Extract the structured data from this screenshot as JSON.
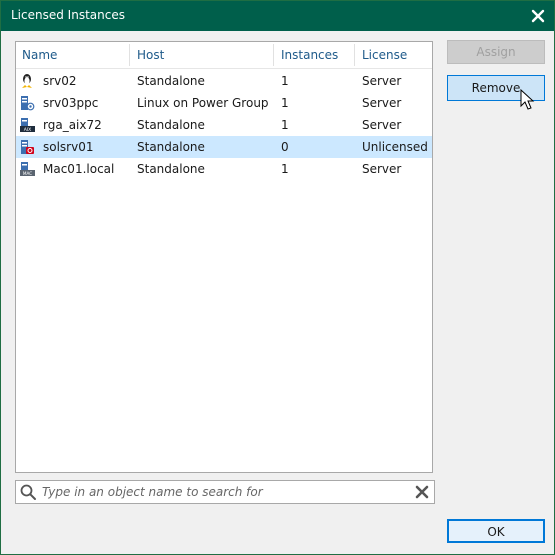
{
  "window": {
    "title": "Licensed Instances"
  },
  "table": {
    "columns": [
      "Name",
      "Host",
      "Instances",
      "License"
    ],
    "rows": [
      {
        "name": "srv02",
        "host": "Standalone",
        "instances": "1",
        "license": "Server",
        "icon": "linux-server-icon"
      },
      {
        "name": "srv03ppc",
        "host": "Linux on Power Group",
        "instances": "1",
        "license": "Server",
        "icon": "power-server-icon"
      },
      {
        "name": "rga_aix72",
        "host": "Standalone",
        "instances": "1",
        "license": "Server",
        "icon": "aix-server-icon"
      },
      {
        "name": "solsrv01",
        "host": "Standalone",
        "instances": "0",
        "license": "Unlicensed",
        "icon": "solaris-server-icon",
        "selected": true
      },
      {
        "name": "Mac01.local",
        "host": "Standalone",
        "instances": "1",
        "license": "Server",
        "icon": "mac-server-icon"
      }
    ]
  },
  "buttons": {
    "assign": "Assign",
    "remove": "Remove",
    "ok": "OK"
  },
  "search": {
    "placeholder": "Type in an object name to search for"
  },
  "colors": {
    "titlebar": "#005f4b",
    "selection": "#cce8ff",
    "header_text": "#1e5a8a",
    "accent": "#0078d7"
  }
}
